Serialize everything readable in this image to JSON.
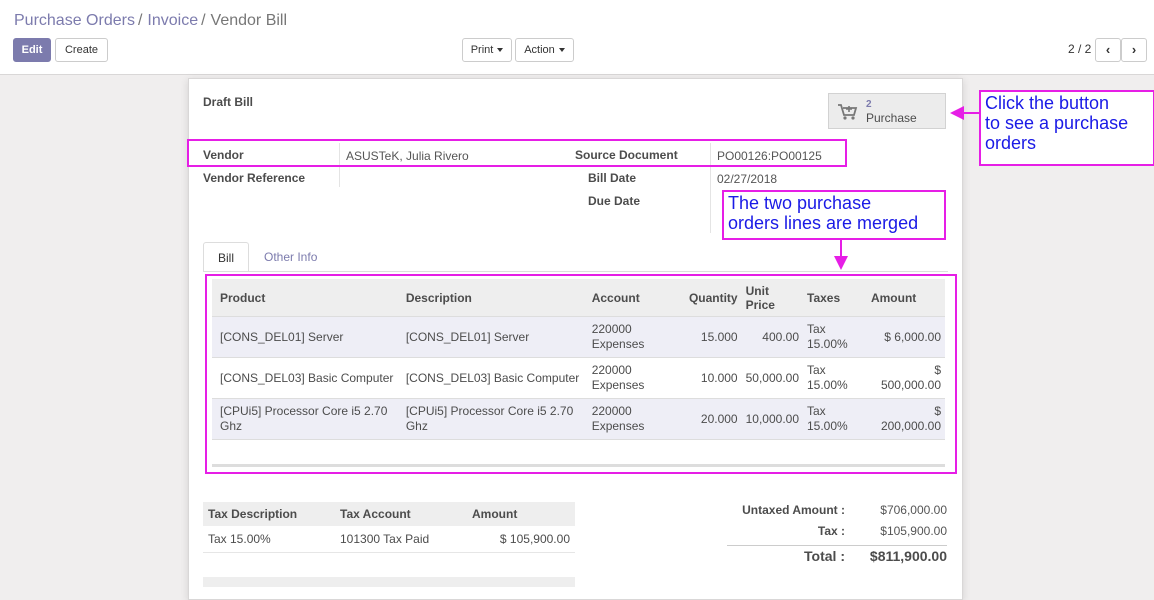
{
  "breadcrumb": {
    "item1": "Purchase Orders",
    "item2": "Invoice",
    "item3": "Vendor Bill",
    "sep": "/"
  },
  "toolbar": {
    "edit_label": "Edit",
    "create_label": "Create",
    "print_label": "Print",
    "action_label": "Action"
  },
  "pager": {
    "value": "2 / 2",
    "prev_icon": "chevron-left-icon",
    "next_icon": "chevron-right-icon"
  },
  "bill": {
    "status": "Draft Bill",
    "smart_button": {
      "count": "2",
      "label": "Purchase",
      "icon": "shopping-cart-icon"
    },
    "fields": {
      "vendor_label": "Vendor",
      "vendor_value": "ASUSTeK, Julia Rivero",
      "vendor_ref_label": "Vendor Reference",
      "vendor_ref_value": "",
      "source_label": "Source Document",
      "source_value": "PO00126:PO00125",
      "bill_date_label": "Bill Date",
      "bill_date_value": "02/27/2018",
      "due_date_label": "Due Date",
      "due_date_value": ""
    },
    "tabs": {
      "bill": "Bill",
      "other": "Other Info"
    },
    "lines": {
      "headers": {
        "product": "Product",
        "description": "Description",
        "account": "Account",
        "quantity": "Quantity",
        "unit_price_1": "Unit",
        "unit_price_2": "Price",
        "taxes": "Taxes",
        "amount": "Amount"
      },
      "rows": [
        {
          "product": "[CONS_DEL01] Server",
          "description": "[CONS_DEL01] Server",
          "account_1": "220000",
          "account_2": "Expenses",
          "quantity": "15.000",
          "unit_price": "400.00",
          "tax_1": "Tax",
          "tax_2": "15.00%",
          "amount": "$ 6,000.00"
        },
        {
          "product": "[CONS_DEL03] Basic Computer",
          "description": "[CONS_DEL03] Basic Computer",
          "account_1": "220000",
          "account_2": "Expenses",
          "quantity": "10.000",
          "unit_price": "50,000.00",
          "tax_1": "Tax",
          "tax_2": "15.00%",
          "amount": "$ 500,000.00"
        },
        {
          "product": "[CPUi5] Processor Core i5 2.70 Ghz",
          "description": "[CPUi5] Processor Core i5 2.70 Ghz",
          "account_1": "220000",
          "account_2": "Expenses",
          "quantity": "20.000",
          "unit_price": "10,000.00",
          "tax_1": "Tax",
          "tax_2": "15.00%",
          "amount": "$ 200,000.00"
        }
      ]
    },
    "taxes": {
      "headers": {
        "description": "Tax Description",
        "account": "Tax Account",
        "amount": "Amount"
      },
      "rows": [
        {
          "description": "Tax 15.00%",
          "account": "101300 Tax Paid",
          "amount": "$ 105,900.00"
        }
      ]
    },
    "totals": {
      "untaxed_label": "Untaxed Amount :",
      "untaxed_value": "$706,000.00",
      "tax_label": "Tax :",
      "tax_value": "$105,900.00",
      "total_label": "Total :",
      "total_value": "$811,900.00"
    }
  },
  "annotations": {
    "note1_line1": "Click the button",
    "note1_line2": "to see a purchase",
    "note1_line3": "orders",
    "note2_line1": "The two purchase",
    "note2_line2": "orders lines are merged"
  },
  "colors": {
    "accent": "#7c7bad",
    "annotation": "#e61ee6",
    "annotation_text": "#1a1ae6"
  }
}
